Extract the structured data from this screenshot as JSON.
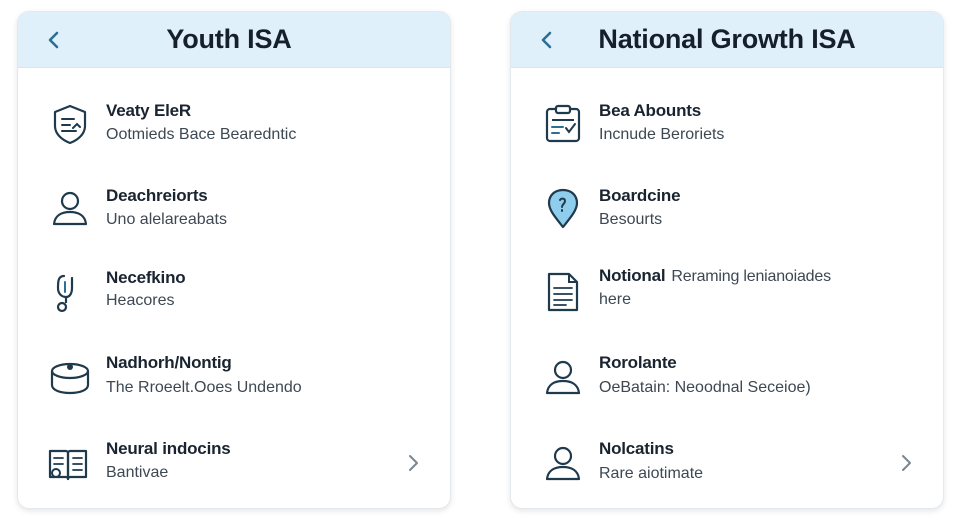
{
  "colors": {
    "header_bg": "#dff0fb",
    "accent": "#2b6f93",
    "icon_stroke": "#1f3a4d",
    "pin_fill": "#8fcdec"
  },
  "left_panel": {
    "title": "Youth ISA",
    "back_icon": "chevron-left-icon",
    "items": [
      {
        "title": "Veaty EleR",
        "subtitle": "Ootmieds Bace Bearedntic",
        "icon": "shield-document-icon"
      },
      {
        "title": "Deachreiorts",
        "subtitle": "Uno alelareabats",
        "icon": "user-icon"
      },
      {
        "title": "Necefkino",
        "subtitle": "Heacores",
        "icon": "stethoscope-icon"
      },
      {
        "title": "Nadhorh/Nontig",
        "subtitle": "The Rroeelt.Ooes Undendo",
        "icon": "cushion-icon"
      },
      {
        "title": "Neural indocins",
        "subtitle": "Bantivae",
        "icon": "open-book-icon",
        "has_chevron": true
      }
    ]
  },
  "right_panel": {
    "title": "National Growth ISA",
    "back_icon": "chevron-left-icon",
    "items": [
      {
        "title": "Bea Abounts",
        "subtitle": "Incnude Beroriets",
        "icon": "clipboard-icon"
      },
      {
        "title": "Boardcine",
        "subtitle": "Besourts",
        "icon": "location-pin-icon"
      },
      {
        "title": "Notional",
        "inline": "Reraming lenianoiades",
        "subtitle": "here",
        "icon": "document-icon"
      },
      {
        "title": "Rorolante",
        "subtitle": "OeBatain: Neoodnal Seceioe)",
        "icon": "user-icon"
      },
      {
        "title": "Nolcatins",
        "subtitle": "Rare aiotimate",
        "icon": "user-icon",
        "has_chevron": true
      }
    ]
  }
}
